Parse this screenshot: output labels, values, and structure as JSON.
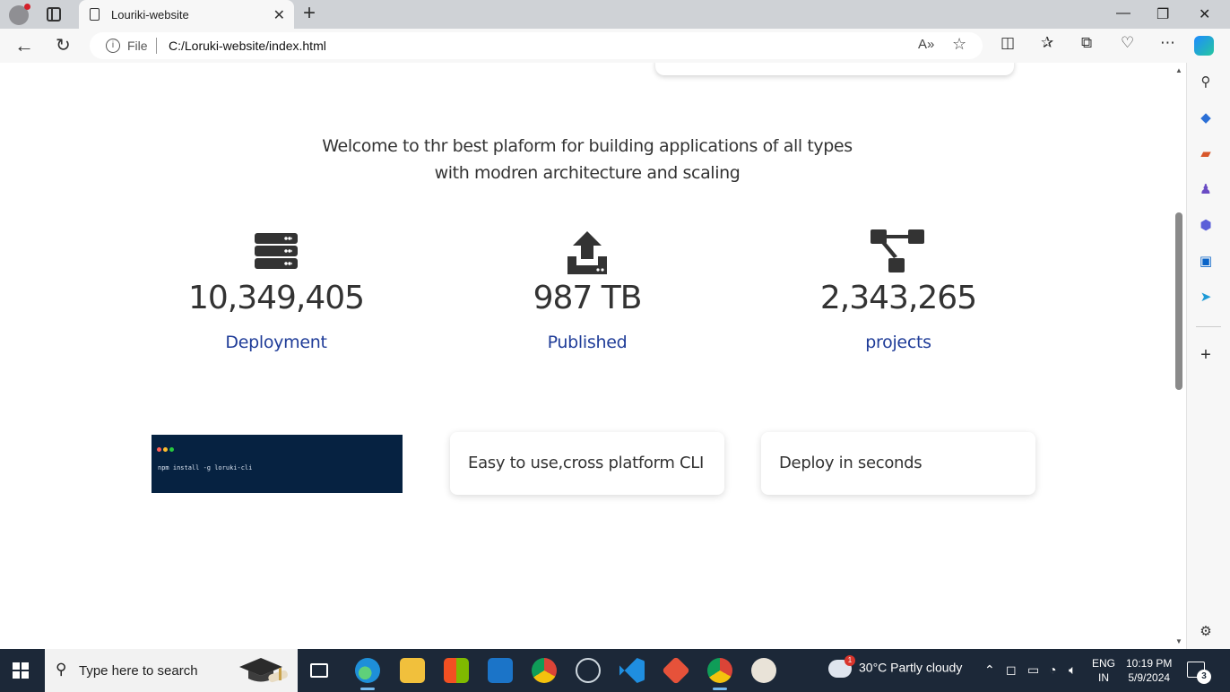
{
  "browser": {
    "tab_title": "Louriki-website",
    "tab_close": "✕",
    "new_tab": "+",
    "url_scheme": "File",
    "url": "C:/Loruki-website/index.html",
    "window_controls": {
      "minimize": "—",
      "maximize": "❐",
      "close": "✕"
    },
    "toolbar_icons": [
      "read-aloud-icon",
      "favorite-star-icon",
      "split-screen-icon",
      "favorites-icon",
      "collections-icon",
      "performance-icon",
      "more-icon",
      "copilot-icon"
    ]
  },
  "page": {
    "intro": "Welcome to thr best plaform for building applications of all types with modren architecture and scaling",
    "stats": [
      {
        "icon": "server-icon",
        "value": "10,349,405",
        "label": "Deployment"
      },
      {
        "icon": "upload-icon",
        "value": "987 TB",
        "label": "Published"
      },
      {
        "icon": "network-icon",
        "value": "2,343,265",
        "label": "projects"
      }
    ],
    "terminal_command": "npm install -g loruki-cli",
    "features": [
      "Easy to use,cross platform CLI",
      "Deploy in seconds"
    ],
    "accent_color": "#1f3c98",
    "terminal_bg": "#062241"
  },
  "edge_sidebar": [
    "search-icon",
    "shopping-tag-icon",
    "tools-icon",
    "games-icon",
    "copilot-apps-icon",
    "outlook-icon",
    "telegram-icon",
    "add-icon",
    "settings-icon"
  ],
  "taskbar": {
    "search_placeholder": "Type here to search",
    "apps": [
      "task-view-icon",
      "edge-icon",
      "file-explorer-icon",
      "store-icon",
      "mail-icon",
      "chrome-icon",
      "whatsapp-icon",
      "vscode-icon",
      "git-icon",
      "chrome-profile-icon",
      "paint-icon"
    ],
    "weather_badge": "1",
    "weather": "30°C  Partly cloudy",
    "lang_line1": "ENG",
    "lang_line2": "IN",
    "time": "10:19 PM",
    "date": "5/9/2024",
    "notifications": "3"
  }
}
